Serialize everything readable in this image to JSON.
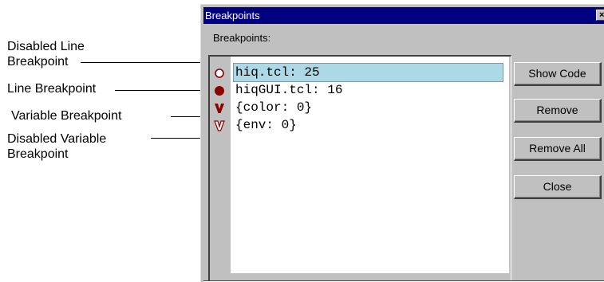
{
  "annotations": {
    "disabled_line_line1": "Disabled Line",
    "disabled_line_line2": "Breakpoint",
    "line": "Line Breakpoint",
    "variable": "Variable Breakpoint",
    "disabled_variable_line1": "Disabled Variable",
    "disabled_variable_line2": "Breakpoint"
  },
  "window": {
    "title": "Breakpoints",
    "close_glyph": "×",
    "group_label": "Breakpoints:"
  },
  "breakpoints": [
    {
      "text": "hiq.tcl: 25",
      "kind": "disabled-line",
      "selected": true
    },
    {
      "text": "hiqGUI.tcl: 16",
      "kind": "line",
      "selected": false
    },
    {
      "text": "{color: 0}",
      "kind": "variable",
      "selected": false
    },
    {
      "text": "{env: 0}",
      "kind": "disabled-variable",
      "selected": false
    }
  ],
  "buttons": {
    "show_code": "Show Code",
    "remove": "Remove",
    "remove_all": "Remove All",
    "close": "Close"
  },
  "colors": {
    "titlebar": "#000080",
    "face": "#c0c0c0",
    "selection": "#add8e6",
    "breakpoint_red": "#8b0000"
  }
}
